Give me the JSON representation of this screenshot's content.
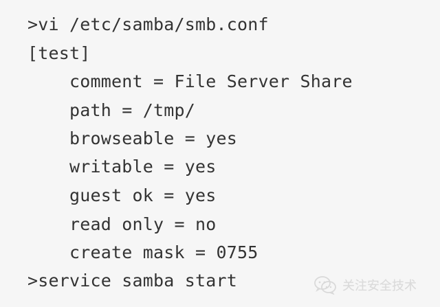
{
  "code": {
    "lines": [
      ">vi /etc/samba/smb.conf",
      "[test]",
      "comment = File Server Share",
      "path = /tmp/",
      "browseable = yes",
      "writable = yes",
      "guest ok = yes",
      "read only = no",
      "create mask = 0755",
      ">service samba start"
    ]
  },
  "watermark": {
    "text": "关注安全技术",
    "icon": "wechat-icon"
  }
}
